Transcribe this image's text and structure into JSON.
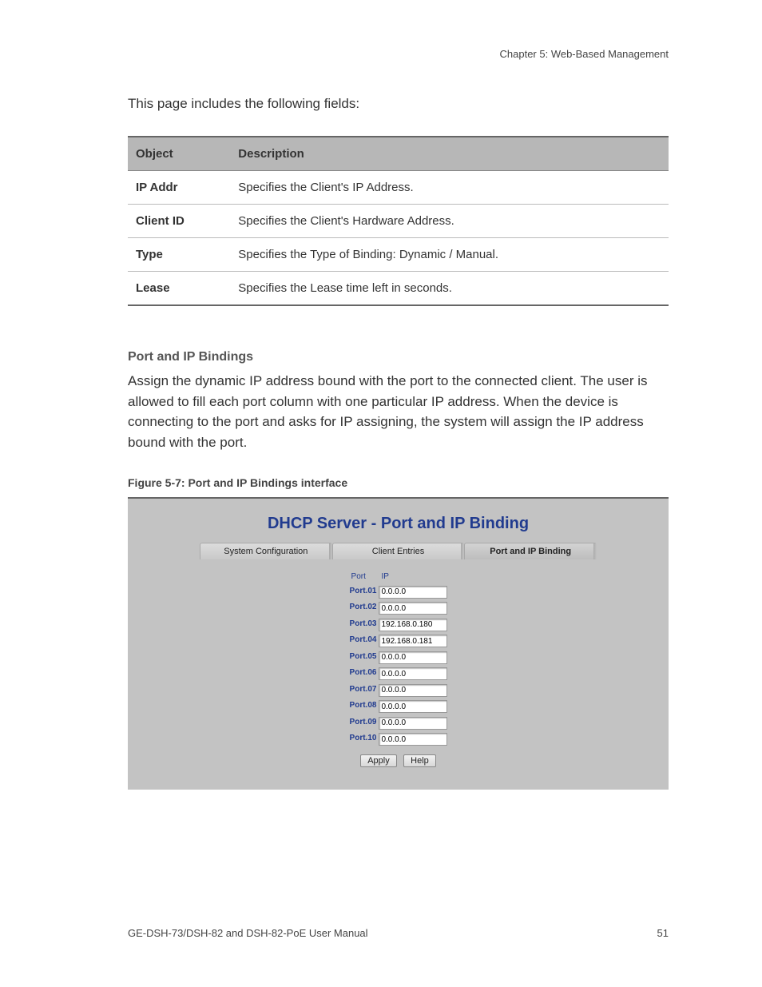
{
  "header": {
    "chapter": "Chapter 5: Web-Based Management"
  },
  "intro": "This page includes the following fields:",
  "fields_table": {
    "headers": [
      "Object",
      "Description"
    ],
    "rows": [
      {
        "object": "IP Addr",
        "description": "Specifies the Client's IP Address."
      },
      {
        "object": "Client ID",
        "description": "Specifies the Client's Hardware Address."
      },
      {
        "object": "Type",
        "description": "Specifies the Type of Binding: Dynamic / Manual."
      },
      {
        "object": "Lease",
        "description": "Specifies the Lease time left in seconds."
      }
    ]
  },
  "section": {
    "heading": "Port and IP Bindings",
    "body": "Assign the dynamic IP address bound with the port to the connected client. The user is allowed to fill each port column with one particular IP address. When the device is connecting to the port and asks for IP assigning, the system will assign the IP address bound with the port."
  },
  "figure_caption": "Figure 5-7:  Port and IP Bindings interface",
  "screenshot": {
    "title": "DHCP Server - Port and IP Binding",
    "tabs": [
      {
        "label": "System Configuration",
        "active": false
      },
      {
        "label": "Client Entries",
        "active": false
      },
      {
        "label": "Port and IP Binding",
        "active": true
      }
    ],
    "port_table": {
      "headers": {
        "port": "Port",
        "ip": "IP"
      },
      "rows": [
        {
          "port": "Port.01",
          "ip": "0.0.0.0"
        },
        {
          "port": "Port.02",
          "ip": "0.0.0.0"
        },
        {
          "port": "Port.03",
          "ip": "192.168.0.180"
        },
        {
          "port": "Port.04",
          "ip": "192.168.0.181"
        },
        {
          "port": "Port.05",
          "ip": "0.0.0.0"
        },
        {
          "port": "Port.06",
          "ip": "0.0.0.0"
        },
        {
          "port": "Port.07",
          "ip": "0.0.0.0"
        },
        {
          "port": "Port.08",
          "ip": "0.0.0.0"
        },
        {
          "port": "Port.09",
          "ip": "0.0.0.0"
        },
        {
          "port": "Port.10",
          "ip": "0.0.0.0"
        }
      ]
    },
    "buttons": {
      "apply": "Apply",
      "help": "Help"
    }
  },
  "footer": {
    "manual": "GE-DSH-73/DSH-82 and DSH-82-PoE User Manual",
    "page": "51"
  }
}
